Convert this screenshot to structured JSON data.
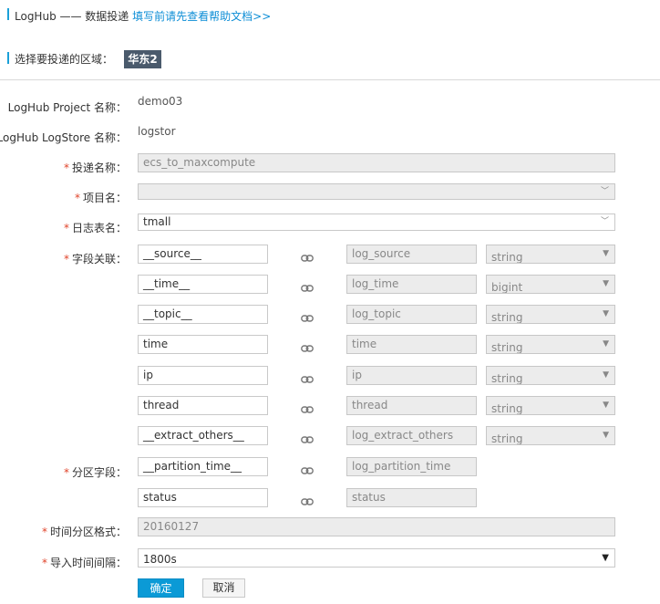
{
  "header": {
    "title": "LogHub —— 数据投递",
    "help_link": "填写前请先查看帮助文档>>"
  },
  "region": {
    "label": "选择要投递的区域：",
    "value": "华东2"
  },
  "form": {
    "project_label": "LogHub Project 名称：",
    "project_value": "demo03",
    "logstore_label": "LogHub LogStore 名称：",
    "logstore_value": "logstor",
    "delivery_name_label": "投递名称：",
    "delivery_name_value": "ecs_to_maxcompute",
    "project_name_label": "项目名：",
    "project_name_value": "",
    "table_name_label": "日志表名：",
    "table_name_value": "tmall",
    "fields_label": "字段关联：",
    "field_rows": [
      {
        "source": "__source__",
        "target": "log_source",
        "type": "string"
      },
      {
        "source": "__time__",
        "target": "log_time",
        "type": "bigint"
      },
      {
        "source": "__topic__",
        "target": "log_topic",
        "type": "string"
      },
      {
        "source": "time",
        "target": "time",
        "type": "string"
      },
      {
        "source": "ip",
        "target": "ip",
        "type": "string"
      },
      {
        "source": "thread",
        "target": "thread",
        "type": "string"
      },
      {
        "source": "__extract_others__",
        "target": "log_extract_others",
        "type": "string"
      }
    ],
    "partition_label": "分区字段：",
    "partition_rows": [
      {
        "source": "__partition_time__",
        "target": "log_partition_time"
      },
      {
        "source": "status",
        "target": "status"
      }
    ],
    "time_format_label": "时间分区格式：",
    "time_format_value": "20160127",
    "interval_label": "导入时间间隔：",
    "interval_value": "1800s",
    "required_mark": "*"
  },
  "buttons": {
    "ok": "确定",
    "cancel": "取消"
  },
  "colors": {
    "accent": "#0b9ad6",
    "badge": "#4a5a6c",
    "required": "#e0442a"
  }
}
